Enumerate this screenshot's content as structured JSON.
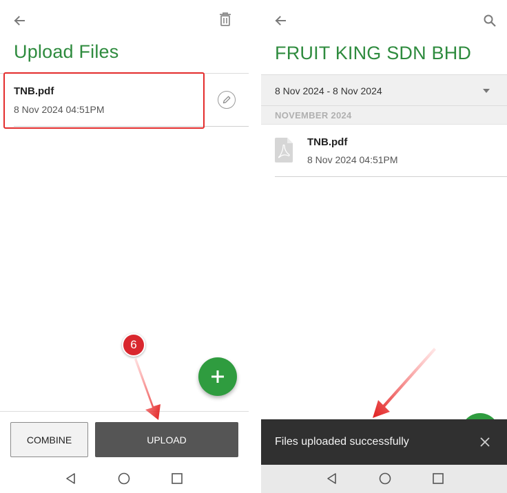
{
  "left_screen": {
    "title": "Upload Files",
    "file": {
      "name": "TNB.pdf",
      "date": "8 Nov 2024 04:51PM"
    },
    "buttons": {
      "combine": "COMBINE",
      "upload": "UPLOAD"
    },
    "step_badge": "6"
  },
  "right_screen": {
    "title": "FRUIT KING SDN BHD",
    "date_filter": "8 Nov 2024 - 8 Nov 2024",
    "month_header": "NOVEMBER 2024",
    "file": {
      "name": "TNB.pdf",
      "date": "8 Nov 2024 04:51PM"
    },
    "snackbar": {
      "message": "Files uploaded successfully"
    }
  },
  "icons": {
    "back": "arrow-left-icon",
    "trash": "trash-icon",
    "edit": "pencil-icon",
    "add": "plus-icon",
    "search": "search-icon",
    "pdf": "pdf-file-icon",
    "close": "close-icon",
    "nav_back": "triangle-back-icon",
    "nav_home": "circle-home-icon",
    "nav_recents": "square-recents-icon"
  },
  "colors": {
    "brand_green": "#2e8b3e",
    "fab_green": "#2f9c3f",
    "highlight_red": "#e32b2b",
    "upload_button": "#555555",
    "snackbar": "#303030"
  }
}
